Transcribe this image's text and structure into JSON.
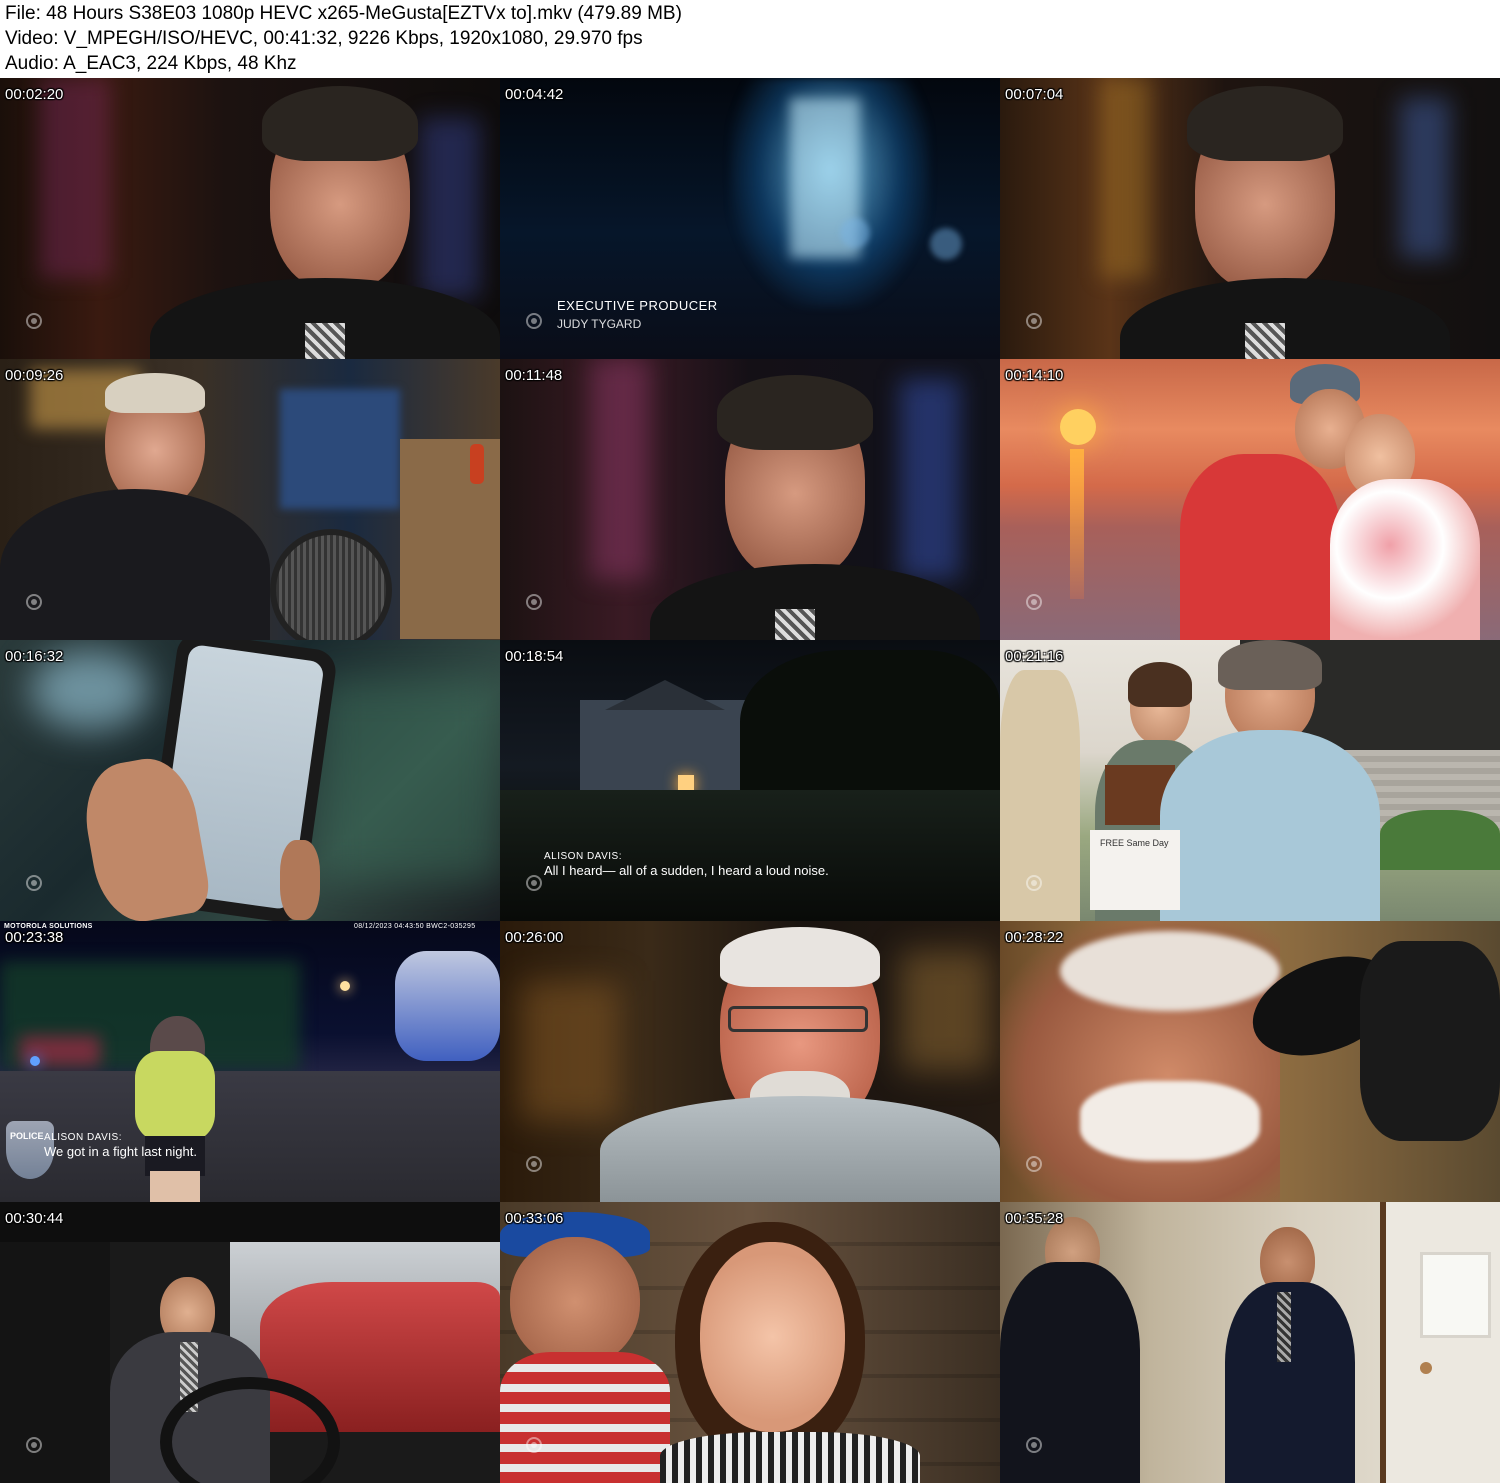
{
  "header": {
    "file_line": "File: 48 Hours S38E03 1080p HEVC x265-MeGusta[EZTVx to].mkv (479.89 MB)",
    "video_line": "Video: V_MPEGH/ISO/HEVC, 00:41:32, 9226 Kbps, 1920x1080, 29.970 fps",
    "audio_line": "Audio: A_EAC3, 224 Kbps, 48 Khz"
  },
  "thumbnails": [
    {
      "timestamp": "00:02:20"
    },
    {
      "timestamp": "00:04:42",
      "caption_title": "EXECUTIVE PRODUCER",
      "caption_name": "JUDY TYGARD"
    },
    {
      "timestamp": "00:07:04"
    },
    {
      "timestamp": "00:09:26"
    },
    {
      "timestamp": "00:11:48"
    },
    {
      "timestamp": "00:14:10"
    },
    {
      "timestamp": "00:16:32"
    },
    {
      "timestamp": "00:18:54",
      "caption_speaker": "ALISON DAVIS:",
      "caption_text": "All I heard— all of a sudden, I heard a loud noise."
    },
    {
      "timestamp": "00:21:16",
      "sign_text": "FREE Same Day"
    },
    {
      "timestamp": "00:23:38",
      "brand": "MOTOROLA SOLUTIONS",
      "bodycam_info": "08/12/2023 04:43:50   BWC2-035295",
      "badge_text": "POLICE",
      "caption_speaker": "ALISON DAVIS:",
      "caption_text": "We got in a fight last night."
    },
    {
      "timestamp": "00:26:00"
    },
    {
      "timestamp": "00:28:22"
    },
    {
      "timestamp": "00:30:44"
    },
    {
      "timestamp": "00:33:06"
    },
    {
      "timestamp": "00:35:28"
    }
  ]
}
